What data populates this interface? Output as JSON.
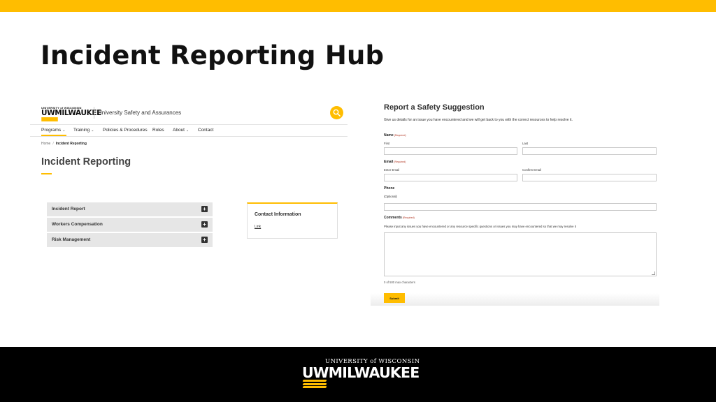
{
  "slide": {
    "title": "Incident Reporting Hub"
  },
  "left_site": {
    "logo_small": "UNIVERSITY of WISCONSIN",
    "logo_big": "UWMILWAUKEE",
    "site_name": "University Safety and Assurances",
    "nav": [
      {
        "label": "Programs",
        "has_dropdown": true
      },
      {
        "label": "Training",
        "has_dropdown": true
      },
      {
        "label": "Policies & Procedures",
        "has_dropdown": false
      },
      {
        "label": "Roles",
        "has_dropdown": false
      },
      {
        "label": "About",
        "has_dropdown": true
      },
      {
        "label": "Contact",
        "has_dropdown": false
      }
    ],
    "breadcrumb": {
      "home": "Home",
      "separator": "/",
      "current": "Incident Reporting"
    },
    "page_title": "Incident Reporting",
    "accordion": [
      {
        "label": "Incident Report"
      },
      {
        "label": "Workers Compensation"
      },
      {
        "label": "Risk Management"
      }
    ],
    "contact": {
      "title": "Contact Information",
      "link": "Link"
    },
    "icons": {
      "search": "search-icon",
      "expand": "plus-icon"
    }
  },
  "right_form": {
    "title": "Report a Safety Suggestion",
    "intro": "Give us details for an issue you have encountered and we will get back to you with the correct resources to help resolve it.",
    "required_tag": "(Required)",
    "name": {
      "label": "Name",
      "first": "First",
      "last": "Last"
    },
    "email": {
      "label": "Email",
      "enter": "Enter Email",
      "confirm": "Confirm Email"
    },
    "phone": {
      "label": "Phone",
      "optional": "(Optional)"
    },
    "comments": {
      "label": "Comments",
      "description": "Please input any issues you have encountered or any resource specific questions or issues you may have encountered so that we may resolve it",
      "char_count": "0 of 500 max characters"
    },
    "submit": "Submit"
  },
  "footer": {
    "logo_small": "UNIVERSITY of WISCONSIN",
    "logo_big": "UWMILWAUKEE"
  },
  "colors": {
    "accent_gold": "#ffbd00",
    "footer_black": "#000000",
    "required_red": "#b0321e"
  }
}
